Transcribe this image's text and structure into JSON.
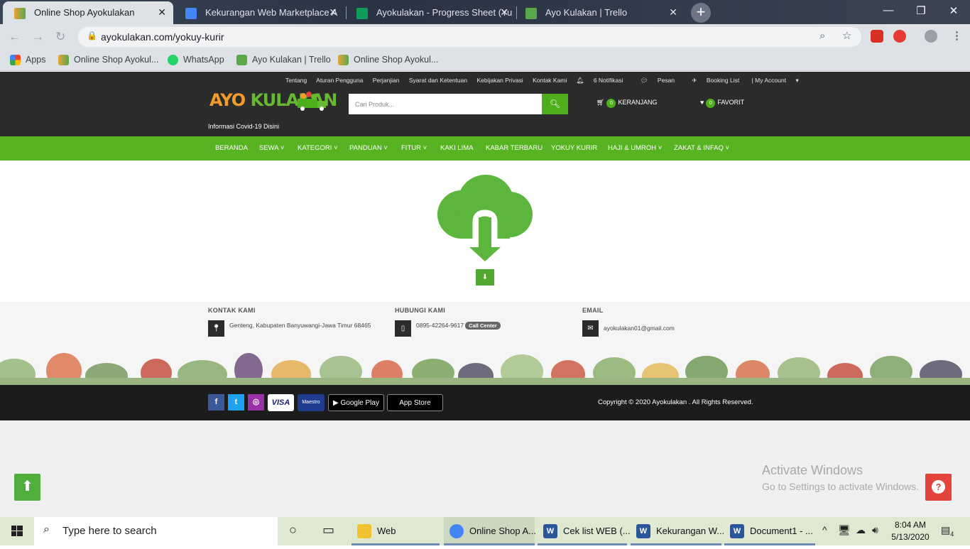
{
  "browser": {
    "tabs": [
      {
        "title": "Online Shop Ayokulakan",
        "icon": "ayokulakan-favicon"
      },
      {
        "title": "Kekurangan Web Marketplace A",
        "icon": "google-docs-icon"
      },
      {
        "title": "Ayokulakan - Progress Sheet (Yu",
        "icon": "google-sheets-icon"
      },
      {
        "title": "Ayo Kulakan | Trello",
        "icon": "trello-icon"
      }
    ],
    "url": "ayokulakan.com/yokuy-kurir",
    "bookmarks": [
      {
        "label": "Apps"
      },
      {
        "label": "Online Shop Ayokul..."
      },
      {
        "label": "WhatsApp"
      },
      {
        "label": "Ayo Kulakan | Trello"
      },
      {
        "label": "Online Shop Ayokul..."
      }
    ]
  },
  "site": {
    "top_links": [
      "Tentang",
      "Aturan Pengguna",
      "Perjanjian",
      "Syarat dan Ketentuan",
      "Kebijakan Privasi",
      "Kontak Kami",
      "6 Notifikasi",
      "Pesan",
      "Booking List",
      "| My Account"
    ],
    "logo_part1": "AYO ",
    "logo_part2": "KULAKAN",
    "covid_link": "Informasi Covid-19 Disini",
    "search_placeholder": "Cari Produk...",
    "cart_count": "0",
    "cart_label": "KERANJANG",
    "fav_count": "0",
    "fav_label": "FAVORIT",
    "nav": [
      "BERANDA",
      "SEWA ˅",
      "KATEGORI ˅",
      "PANDUAN ˅",
      "FITUR ˅",
      "KAKI LIMA",
      "KABAR TERBARU",
      "YOKUY KURIR",
      "HAJI & UMROH ˅",
      "ZAKAT & INFAQ ˅"
    ]
  },
  "footer": {
    "contact_title": "KONTAK KAMI",
    "contact_address": "Genteng, Kabupaten Banyuwangi-Jawa Timur 68465",
    "hub_title": "HUBUNGI KAMI",
    "hub_phone": "0895-42264-9617",
    "hub_badge": "Call Center",
    "email_title": "EMAIL",
    "email_value": "ayokulakan01@gmail.com",
    "social": [
      "f",
      "t",
      "◎"
    ],
    "payments": [
      "VISA",
      "Maestro",
      "Google Play",
      "App Store"
    ],
    "copyright": "Copyright © 2020 Ayokulakan . All Rights Reserved."
  },
  "watermark": {
    "line1": "Activate Windows",
    "line2": "Go to Settings to activate Windows."
  },
  "taskbar": {
    "search_placeholder": "Type here to search",
    "apps": [
      {
        "label": "Web",
        "icon": "folder-icon"
      },
      {
        "label": "Online Shop A...",
        "icon": "chrome-icon"
      },
      {
        "label": "Cek list WEB (...",
        "icon": "word-icon"
      },
      {
        "label": "Kekurangan W...",
        "icon": "word-icon"
      },
      {
        "label": "Document1 - ...",
        "icon": "word-icon"
      }
    ],
    "time": "8:04 AM",
    "date": "5/13/2020",
    "notification_count": "4"
  },
  "colors": {
    "brand_green": "#57b321",
    "brand_orange": "#f39b2b",
    "header_dark": "#2b2b2b"
  }
}
